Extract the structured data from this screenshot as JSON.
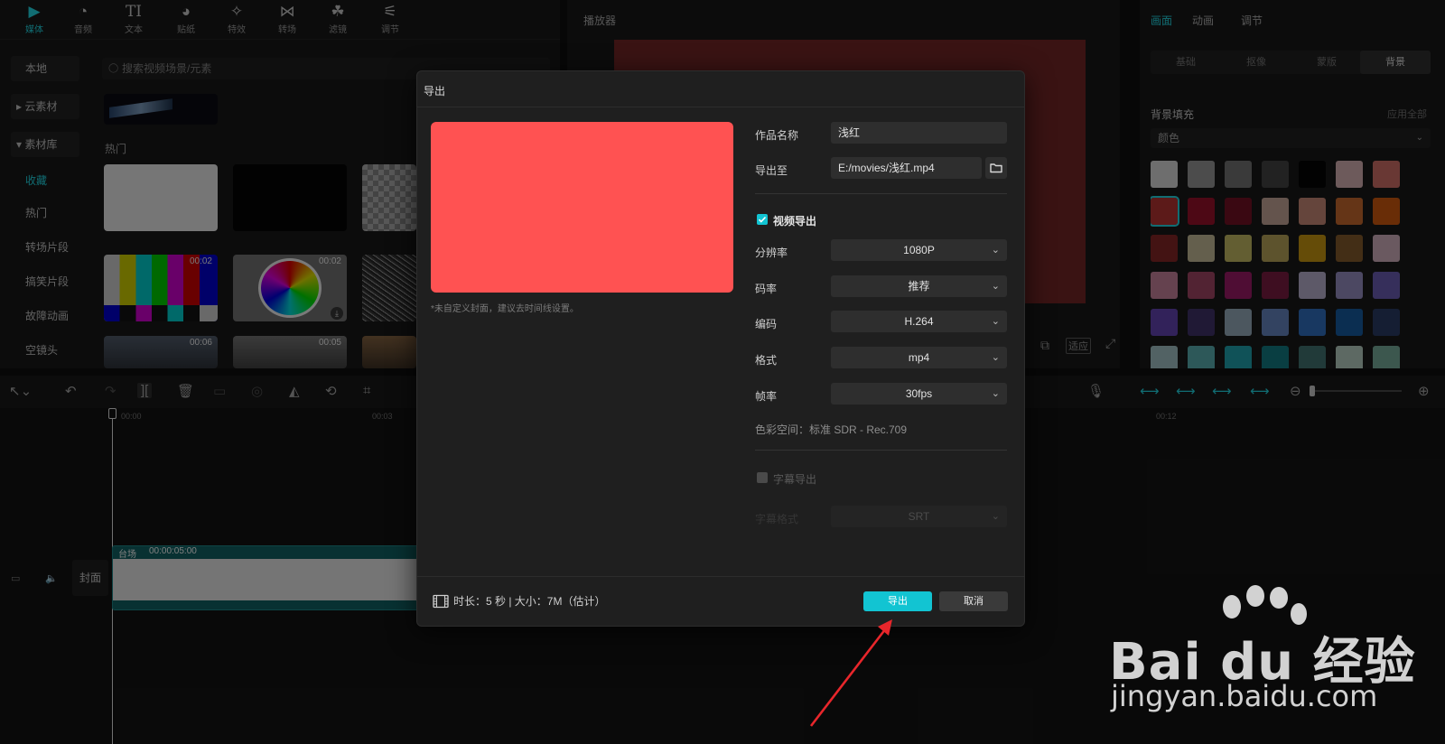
{
  "media_panel": {
    "tabs": [
      {
        "label": "媒体",
        "icon": "media-icon"
      },
      {
        "label": "音频",
        "icon": "audio-icon"
      },
      {
        "label": "文本",
        "icon": "text-icon",
        "glyph": "TI"
      },
      {
        "label": "贴纸",
        "icon": "sticker-icon"
      },
      {
        "label": "特效",
        "icon": "effects-icon"
      },
      {
        "label": "转场",
        "icon": "transition-icon"
      },
      {
        "label": "滤镜",
        "icon": "filter-icon"
      },
      {
        "label": "调节",
        "icon": "adjust-icon"
      }
    ],
    "sidebar": [
      "本地",
      "▸ 云素材",
      "▾ 素材库",
      "收藏",
      "热门",
      "转场片段",
      "搞笑片段",
      "故障动画",
      "空镜头"
    ],
    "search_placeholder": "搜索视频场景/元素",
    "section_hot": "热门",
    "durations": [
      "00:02",
      "00:02",
      "00:06",
      "00:05"
    ]
  },
  "player": {
    "title": "播放器",
    "controls": [
      "适应"
    ]
  },
  "properties": {
    "tabs": [
      "画面",
      "动画",
      "调节"
    ],
    "subtabs": [
      "基础",
      "抠像",
      "蒙版",
      "背景"
    ],
    "section": "背景填充",
    "apply_all": "应用全部",
    "fill_type": "颜色",
    "swatches": [
      "#c9c9c9",
      "#8a8a8a",
      "#6a6a6a",
      "#3f3f3f",
      "#050505",
      "#c7a4a7",
      "#c0675f",
      "#a8312f",
      "#8d1027",
      "#6b1022",
      "#b69a8d",
      "#b97f6d",
      "#b8622b",
      "#c0530d",
      "#7a2323",
      "#b6ad8c",
      "#b4ab5c",
      "#a99852",
      "#b98a10",
      "#7b5429",
      "#c1a3b0",
      "#b87890",
      "#96405e",
      "#91195f",
      "#721a3c",
      "#a9a2bd",
      "#8b83b3",
      "#6357a6",
      "#5b3fa5",
      "#3b2f62",
      "#8a9eae",
      "#5d7ab1",
      "#2d66b1",
      "#155494",
      "#27375e",
      "#96b3b6",
      "#52a0a3",
      "#1e96a0",
      "#127178",
      "#3d6b69",
      "#a9c0b4",
      "#6e9e8e"
    ]
  },
  "timeline": {
    "ticks": [
      "00:00",
      "00:03",
      "00:12"
    ],
    "track_label": "封面",
    "clip_tag": "台场",
    "clip_time": "00:00:05:00"
  },
  "dialog": {
    "title": "导出",
    "cover_hint": "*未自定义封面，建议去时间线设置。",
    "name_label": "作品名称",
    "name_value": "浅红",
    "export_to_label": "导出至",
    "export_path": "E:/movies/浅红.mp4",
    "video_export_label": "视频导出",
    "resolution_label": "分辨率",
    "resolution_value": "1080P",
    "bitrate_label": "码率",
    "bitrate_value": "推荐",
    "codec_label": "编码",
    "codec_value": "H.264",
    "format_label": "格式",
    "format_value": "mp4",
    "framerate_label": "帧率",
    "framerate_value": "30fps",
    "color_space": "色彩空间：标准 SDR - Rec.709",
    "subtitle_export_label": "字幕导出",
    "subtitle_format_label": "字幕格式",
    "subtitle_format_value": "SRT",
    "summary": "时长：5 秒 | 大小：7M（估计）",
    "export_button": "导出",
    "cancel_button": "取消",
    "accent": "#12c4d2",
    "cover_color": "#ff5252"
  },
  "watermark": {
    "brand": "Bai du 经验",
    "url": "jingyan.baidu.com"
  }
}
